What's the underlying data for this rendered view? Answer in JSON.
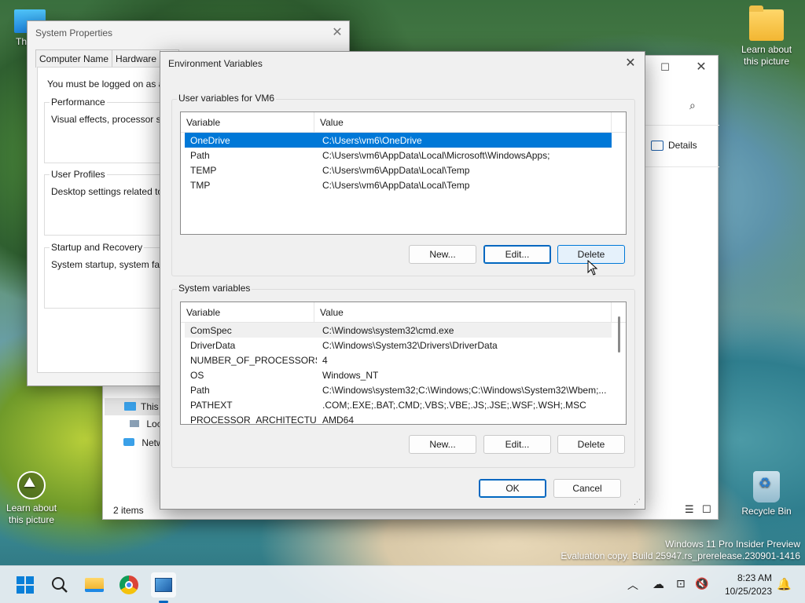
{
  "desktop": {
    "icons": [
      {
        "label": "Th"
      },
      {
        "label": "Learn about this picture"
      },
      {
        "label": "Learn about this picture"
      },
      {
        "label": "Recycle Bin"
      }
    ],
    "watermark_line1": "Windows 11 Pro Insider Preview",
    "watermark_line2": "Evaluation copy. Build 25947.rs_prerelease.230901-1416"
  },
  "system_properties": {
    "title": "System Properties",
    "tabs": [
      "Computer Name",
      "Hardware",
      "Ad"
    ],
    "intro": "You must be logged on as an A",
    "groups": [
      {
        "title": "Performance",
        "text": "Visual effects, processor sche"
      },
      {
        "title": "User Profiles",
        "text": "Desktop settings related to yo"
      },
      {
        "title": "Startup and Recovery",
        "text": "System startup, system failure"
      }
    ]
  },
  "explorer": {
    "details_label": "Details",
    "nav_items": [
      "This",
      "Loc",
      "Netw"
    ],
    "status": "2 items"
  },
  "env_dialog": {
    "title": "Environment Variables",
    "user_group_title": "User variables for VM6",
    "system_group_title": "System variables",
    "col_variable": "Variable",
    "col_value": "Value",
    "user_vars": [
      {
        "name": "OneDrive",
        "value": "C:\\Users\\vm6\\OneDrive"
      },
      {
        "name": "Path",
        "value": "C:\\Users\\vm6\\AppData\\Local\\Microsoft\\WindowsApps;"
      },
      {
        "name": "TEMP",
        "value": "C:\\Users\\vm6\\AppData\\Local\\Temp"
      },
      {
        "name": "TMP",
        "value": "C:\\Users\\vm6\\AppData\\Local\\Temp"
      }
    ],
    "system_vars": [
      {
        "name": "ComSpec",
        "value": "C:\\Windows\\system32\\cmd.exe"
      },
      {
        "name": "DriverData",
        "value": "C:\\Windows\\System32\\Drivers\\DriverData"
      },
      {
        "name": "NUMBER_OF_PROCESSORS",
        "value": "4"
      },
      {
        "name": "OS",
        "value": "Windows_NT"
      },
      {
        "name": "Path",
        "value": "C:\\Windows\\system32;C:\\Windows;C:\\Windows\\System32\\Wbem;..."
      },
      {
        "name": "PATHEXT",
        "value": ".COM;.EXE;.BAT;.CMD;.VBS;.VBE;.JS;.JSE;.WSF;.WSH;.MSC"
      },
      {
        "name": "PROCESSOR_ARCHITECTURE",
        "value": "AMD64"
      }
    ],
    "buttons": {
      "new": "New...",
      "edit": "Edit...",
      "delete": "Delete",
      "ok": "OK",
      "cancel": "Cancel"
    }
  },
  "taskbar": {
    "time": "8:23 AM",
    "date": "10/25/2023"
  }
}
